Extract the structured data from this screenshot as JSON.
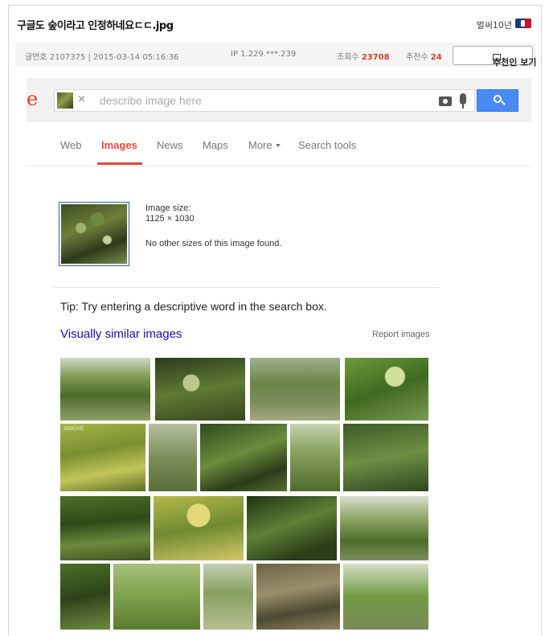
{
  "post": {
    "title": "구글도 숲이라고 인정하네요ㄷㄷ.jpg",
    "author": "벌써10년",
    "number": "글번호 2107375 | 2015-03-14 05:16:36",
    "ip": "IP 1.229.***.239",
    "views_label": "조회수",
    "views": "23708",
    "recommend_label": "추천수",
    "recommend": "24",
    "recommender_button": "추천인 보기"
  },
  "google": {
    "logo_fragment": "e",
    "search_placeholder": "describe image here",
    "chip_close": "×",
    "tabs": [
      {
        "label": "Web"
      },
      {
        "label": "Images"
      },
      {
        "label": "News"
      },
      {
        "label": "Maps"
      },
      {
        "label": "More"
      },
      {
        "label": "Search tools"
      }
    ],
    "image_size_label": "Image size:",
    "image_size_value": "1125 × 1030",
    "no_other_sizes": "No other sizes of this image found.",
    "tip": "Tip: Try entering a descriptive word in the search box.",
    "similar_heading": "Visually similar images",
    "report_link": "Report images",
    "watermark": "ARKIVE"
  },
  "colors": {
    "accent_red": "#dd4b39",
    "search_blue": "#4a8af4",
    "link_blue": "#1a0dab",
    "count_orange": "#d1441b"
  }
}
